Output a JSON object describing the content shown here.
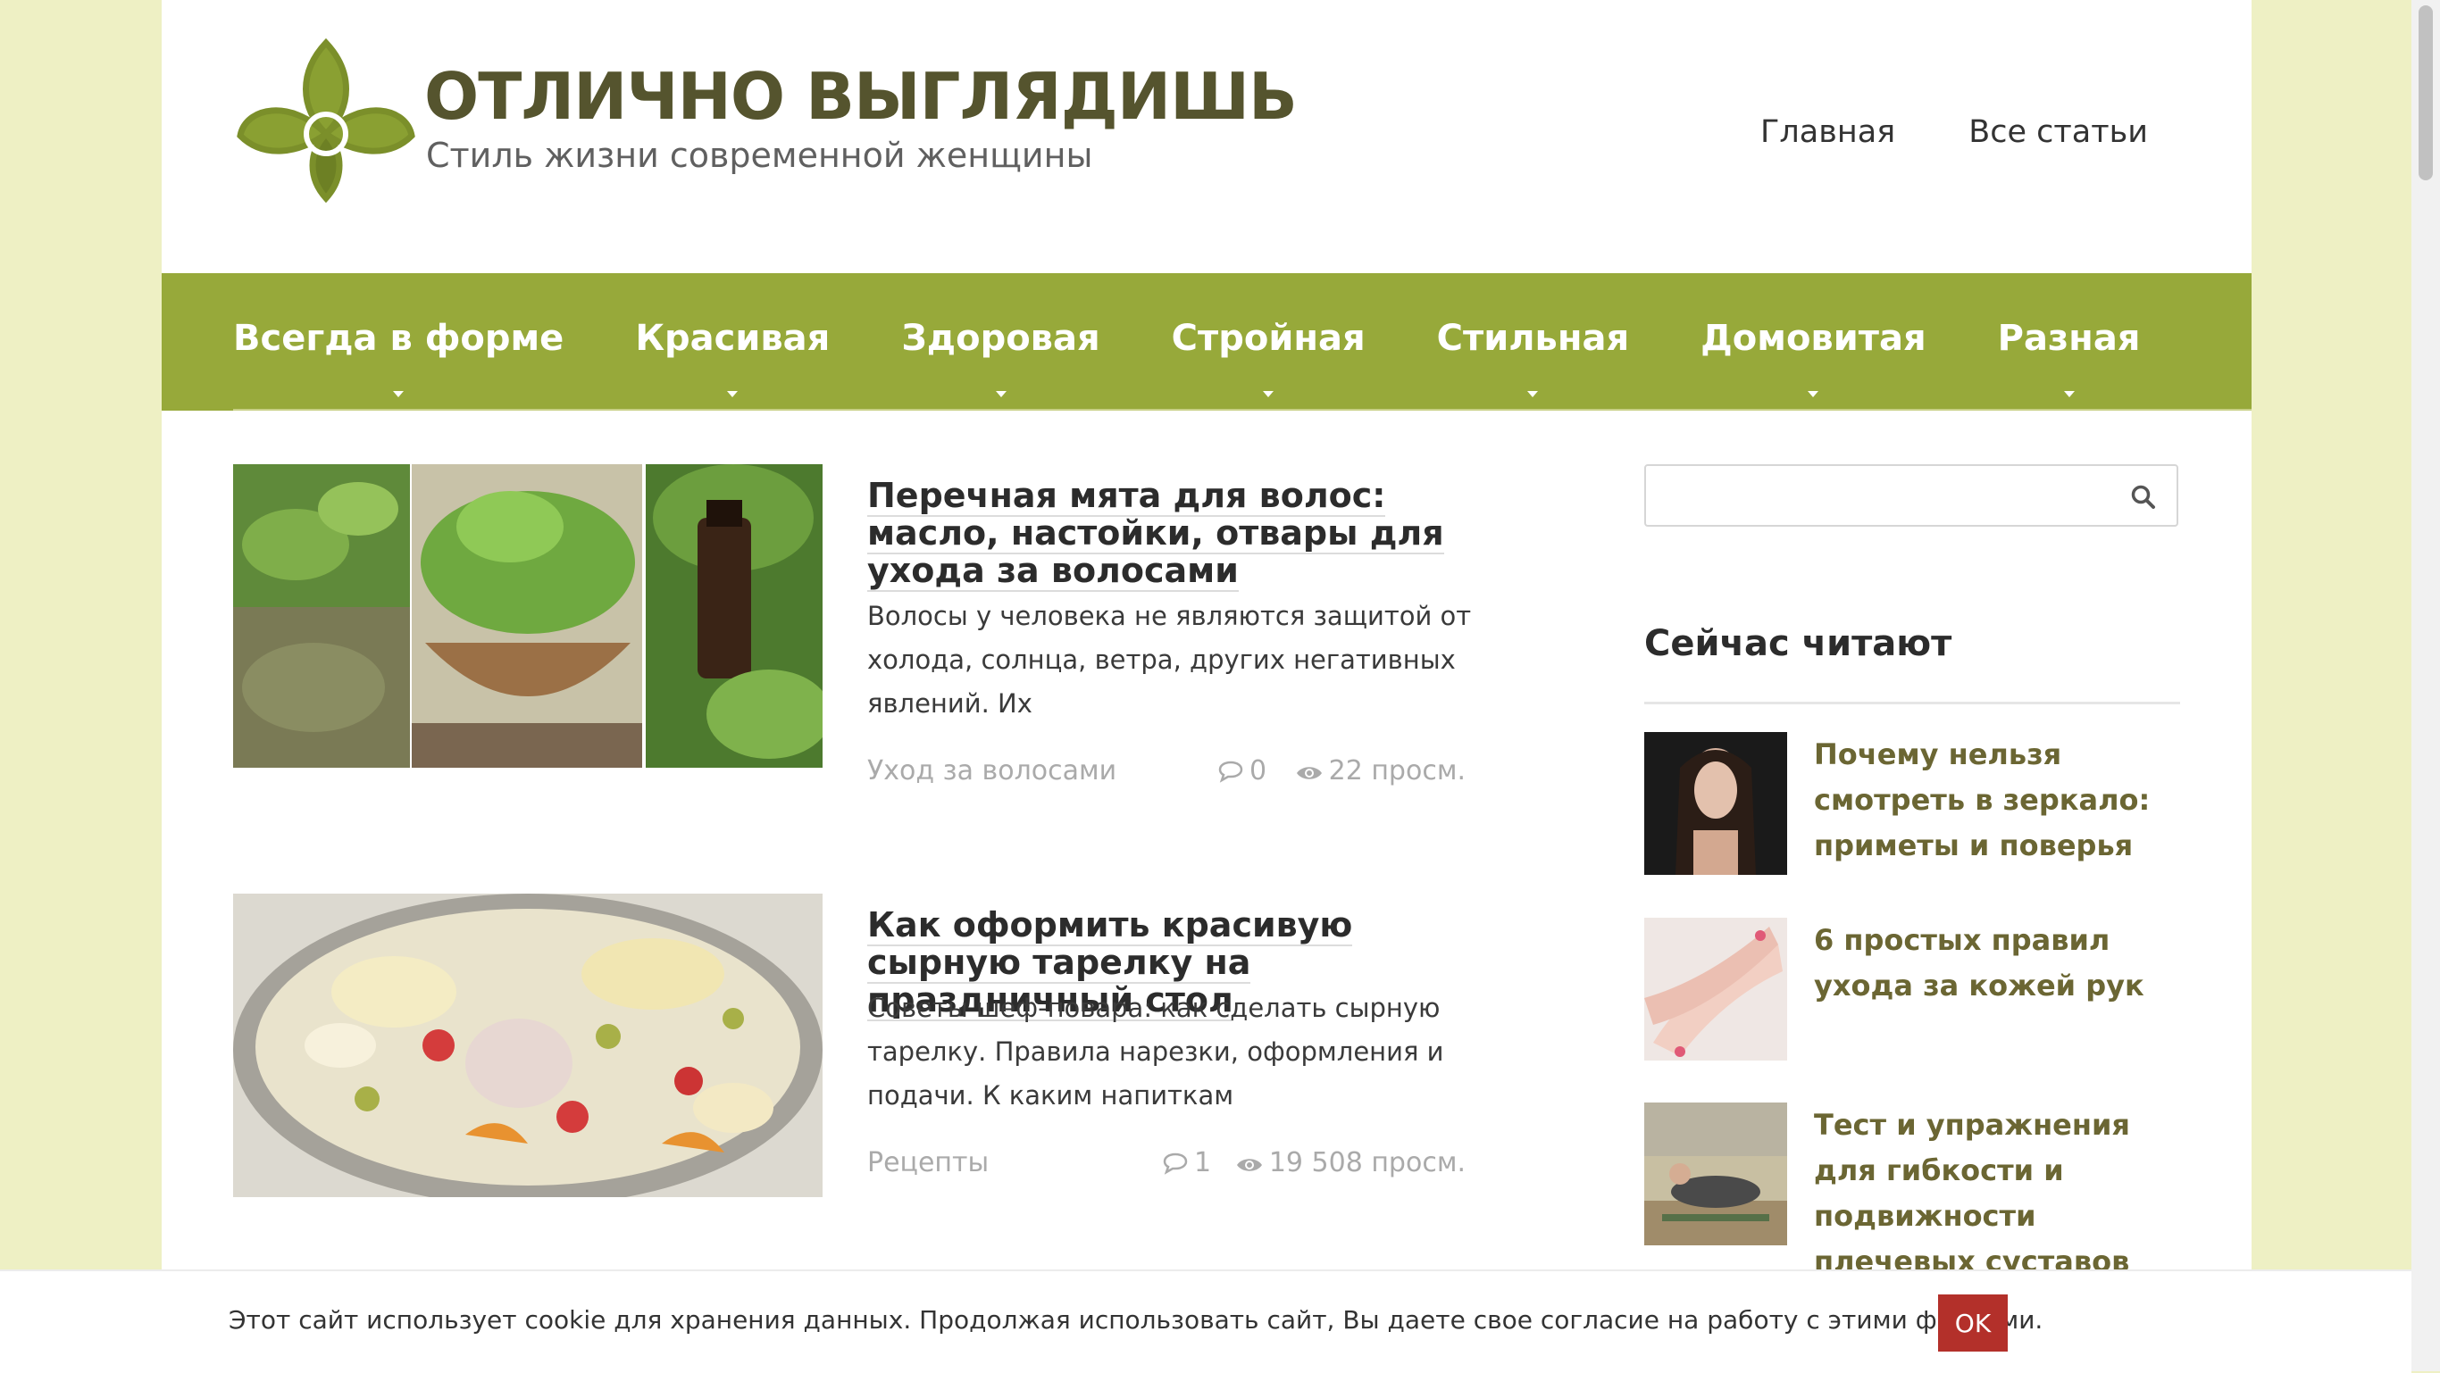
{
  "site": {
    "title": "ОТЛИЧНО ВЫГЛЯДИШЬ",
    "subtitle": "Стиль жизни современной женщины"
  },
  "topnav": [
    "Главная",
    "Все статьи"
  ],
  "menu": [
    "Всегда в форме",
    "Красивая",
    "Здоровая",
    "Стройная",
    "Стильная",
    "Домовитая",
    "Разная"
  ],
  "articles": [
    {
      "title": "Перечная мята для волос: масло, настойки, отвары для ухода за волосами",
      "excerpt": "Волосы у человека не являются защитой от холода, солнца, ветра, других негативных явлений. Их",
      "category": "Уход за волосами",
      "comments": "0",
      "views": "22 просм."
    },
    {
      "title": "Как оформить красивую сырную тарелку на праздничный стол",
      "excerpt": "Советы шеф-повара: как сделать сырную тарелку. Правила нарезки, оформления и подачи. К каким напиткам",
      "category": "Рецепты",
      "comments": "1",
      "views": "19 508 просм."
    }
  ],
  "sidebar": {
    "search_placeholder": "",
    "heading": "Сейчас читают",
    "items": [
      "Почему нельзя смотреть в зеркало: приметы и поверья",
      "6 простых правил ухода за кожей рук",
      "Тест и упражнения для гибкости и подвижности плечевых суставов"
    ]
  },
  "cookie": {
    "text": "Этот сайт использует cookie для хранения данных. Продолжая использовать сайт, Вы даете свое согласие на работу с этими файлами.",
    "button": "OK"
  },
  "colors": {
    "menu_green": "#97a93a",
    "logo_green": "#7b8f2a",
    "page_bg": "#eef0c4",
    "ok_red": "#b3302a"
  }
}
